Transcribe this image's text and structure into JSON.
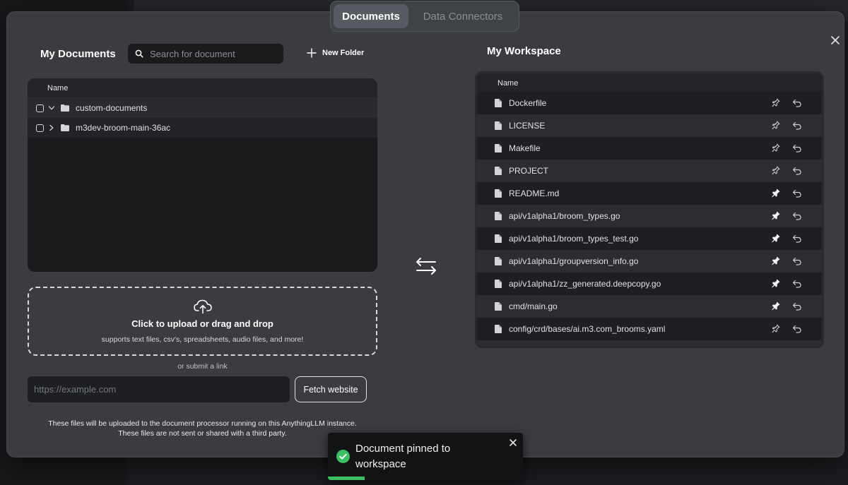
{
  "tabs": [
    {
      "label": "Documents",
      "active": true
    },
    {
      "label": "Data Connectors",
      "active": false
    }
  ],
  "my_documents": {
    "title": "My Documents",
    "search_placeholder": "Search for document",
    "new_folder_label": "New Folder",
    "column_name": "Name",
    "folders": [
      {
        "name": "custom-documents",
        "expanded": true
      },
      {
        "name": "m3dev-broom-main-36ac",
        "expanded": false
      }
    ]
  },
  "upload": {
    "title": "Click to upload or drag and drop",
    "subtitle": "supports text files, csv's, spreadsheets, audio files, and more!",
    "or_link": "or submit a link",
    "url_placeholder": "https://example.com",
    "fetch_label": "Fetch website",
    "note_line1": "These files will be uploaded to the document processor running on this AnythingLLM instance.",
    "note_line2": "These files are not sent or shared with a third party."
  },
  "workspace": {
    "title": "My Workspace",
    "column_name": "Name",
    "files": [
      {
        "name": "Dockerfile",
        "pinned": false
      },
      {
        "name": "LICENSE",
        "pinned": false
      },
      {
        "name": "Makefile",
        "pinned": false
      },
      {
        "name": "PROJECT",
        "pinned": false
      },
      {
        "name": "README.md",
        "pinned": true
      },
      {
        "name": "api/v1alpha1/broom_types.go",
        "pinned": true
      },
      {
        "name": "api/v1alpha1/broom_types_test.go",
        "pinned": true
      },
      {
        "name": "api/v1alpha1/groupversion_info.go",
        "pinned": true
      },
      {
        "name": "api/v1alpha1/zz_generated.deepcopy.go",
        "pinned": true
      },
      {
        "name": "cmd/main.go",
        "pinned": true
      },
      {
        "name": "config/crd/bases/ai.m3.com_brooms.yaml",
        "pinned": false
      }
    ]
  },
  "toast": {
    "message": "Document pinned to workspace",
    "progress": 0.19,
    "color": "#3cbf62"
  },
  "icons": {
    "close": "close-icon",
    "search": "search-icon",
    "plus": "plus-icon",
    "swap": "swap-arrows-icon",
    "pin": "pin-icon",
    "undo": "undo-icon",
    "file": "file-icon",
    "folder": "folder-icon",
    "upload": "cloud-upload-icon",
    "check": "check-circle-icon"
  }
}
